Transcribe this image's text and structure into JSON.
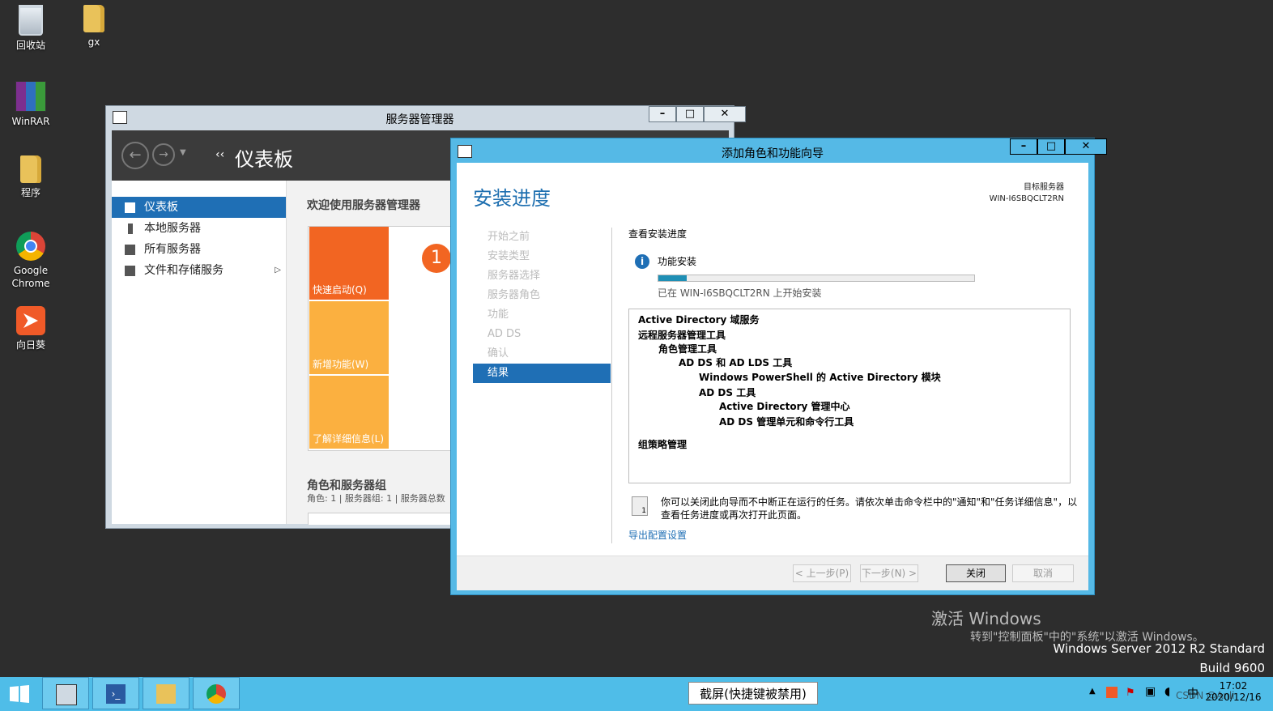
{
  "desktop": {
    "icons": [
      {
        "label": "回收站",
        "icon": "recycle-bin-icon"
      },
      {
        "label": "gx",
        "icon": "folder-icon"
      },
      {
        "label": "WinRAR",
        "icon": "winrar-icon"
      },
      {
        "label": "程序",
        "icon": "folder-icon"
      },
      {
        "label": "Google\nChrome",
        "line1": "Google",
        "line2": "Chrome",
        "icon": "chrome-icon"
      },
      {
        "label": "向日葵",
        "icon": "sunlogin-icon"
      }
    ]
  },
  "server_manager": {
    "title": "服务器管理器",
    "nav_title": "仪表板",
    "nav_prefix": "‹‹",
    "sidebar": [
      {
        "label": "仪表板",
        "selected": true
      },
      {
        "label": "本地服务器"
      },
      {
        "label": "所有服务器"
      },
      {
        "label": "文件和存储服务",
        "expand": "▷"
      }
    ],
    "welcome": "欢迎使用服务器管理器",
    "badge": "1",
    "tiles": [
      "快速启动(Q)",
      "新增功能(W)",
      "了解详细信息(L)"
    ],
    "roles_heading": "角色和服务器组",
    "roles_summary": "角色: 1 | 服务器组: 1 | 服务器总数"
  },
  "wizard": {
    "title": "添加角色和功能向导",
    "heading": "安装进度",
    "target_label": "目标服务器",
    "target_server": "WIN-I6SBQCLT2RN",
    "steps": [
      "开始之前",
      "安装类型",
      "服务器选择",
      "服务器角色",
      "功能",
      "AD DS",
      "确认",
      "结果"
    ],
    "selected_step": "结果",
    "view_progress": "查看安装进度",
    "feature_install": "功能安装",
    "progress": 0.09,
    "status": "已在 WIN-I6SBQCLT2RN 上开始安装",
    "results": [
      "Active Directory 域服务",
      "远程服务器管理工具",
      "角色管理工具",
      "AD DS 和 AD LDS 工具",
      "Windows PowerShell 的 Active Directory 模块",
      "AD DS 工具",
      "Active Directory 管理中心",
      "AD DS 管理单元和命令行工具",
      "组策略管理"
    ],
    "note_line1": "你可以关闭此向导而不中断正在运行的任务。请依次单击命令栏中的\"通知\"和\"任务详细信息\"，以",
    "note_line2": "查看任务进度或再次打开此页面。",
    "note_badge": "1",
    "export_link": "导出配置设置",
    "buttons": {
      "prev": "< 上一步(P)",
      "next": "下一步(N) >",
      "close": "关闭",
      "cancel": "取消"
    }
  },
  "watermark": {
    "activate": "激活 Windows",
    "activate_hint": "转到\"控制面板\"中的\"系统\"以激活 Windows。",
    "edition": "Windows Server 2012 R2 Standard",
    "build": "Build 9600"
  },
  "taskbar": {
    "apps": [
      "start-icon",
      "server-manager-icon",
      "powershell-icon",
      "file-explorer-icon",
      "chrome-icon"
    ],
    "screenshot_label": "截屏(快捷键被禁用)",
    "tray_lang": "中",
    "clock_time": "17:02",
    "clock_date": "2020/12/16",
    "csdn": "CSDN @Anli"
  },
  "colors": {
    "accent": "#1f6fb5",
    "wizard_frame": "#55b9e6",
    "tile_orange": "#f26522",
    "tile_amber": "#fbb040",
    "taskbar": "#4fbde8"
  }
}
